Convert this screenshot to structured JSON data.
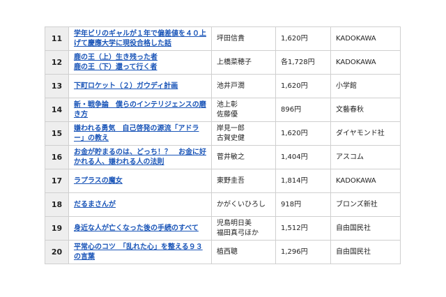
{
  "ranking": {
    "rows": [
      {
        "rank": "11",
        "title": [
          "学年ビリのギャルが１年で偏差値を４０上げて慶應大学に現役合格した話"
        ],
        "authors": [
          "坪田信貴"
        ],
        "price": "1,620円",
        "publisher": "KADOKAWA"
      },
      {
        "rank": "12",
        "title": [
          "鹿の王（上）生き残った者",
          "鹿の王（下）還って行く者"
        ],
        "authors": [
          "上橋菜穂子"
        ],
        "price": "各1,728円",
        "publisher": "KADOKAWA"
      },
      {
        "rank": "13",
        "title": [
          "下町ロケット（２）ガウディ計画"
        ],
        "authors": [
          "池井戸潤"
        ],
        "price": "1,620円",
        "publisher": "小学館"
      },
      {
        "rank": "14",
        "title": [
          "新・戦争論　僕らのインテリジェンスの磨き方"
        ],
        "authors": [
          "池上彰",
          "佐藤優"
        ],
        "price": "896円",
        "publisher": "文藝春秋"
      },
      {
        "rank": "15",
        "title": [
          "嫌われる勇気　自己啓発の源流「アドラー」の教え"
        ],
        "authors": [
          "岸見一郎",
          "古賀史健"
        ],
        "price": "1,620円",
        "publisher": "ダイヤモンド社"
      },
      {
        "rank": "16",
        "title": [
          "お金が貯まるのは、どっち！？　お金に好かれる人、嫌われる人の法則"
        ],
        "authors": [
          "菅井敏之"
        ],
        "price": "1,404円",
        "publisher": "アスコム"
      },
      {
        "rank": "17",
        "title": [
          "ラプラスの魔女"
        ],
        "authors": [
          "東野圭吾"
        ],
        "price": "1,814円",
        "publisher": "KADOKAWA"
      },
      {
        "rank": "18",
        "title": [
          "だるまさんが"
        ],
        "authors": [
          "かがくいひろし"
        ],
        "price": "918円",
        "publisher": "ブロンズ新社"
      },
      {
        "rank": "19",
        "title": [
          "身近な人が亡くなった後の手続のすべて"
        ],
        "authors": [
          "児島明日美",
          "福田真弓ほか"
        ],
        "price": "1,512円",
        "publisher": "自由国民社"
      },
      {
        "rank": "20",
        "title": [
          "平常心のコツ　「乱れた心」を整える９３の言葉"
        ],
        "authors": [
          "植西聰"
        ],
        "price": "1,296円",
        "publisher": "自由国民社"
      }
    ]
  }
}
